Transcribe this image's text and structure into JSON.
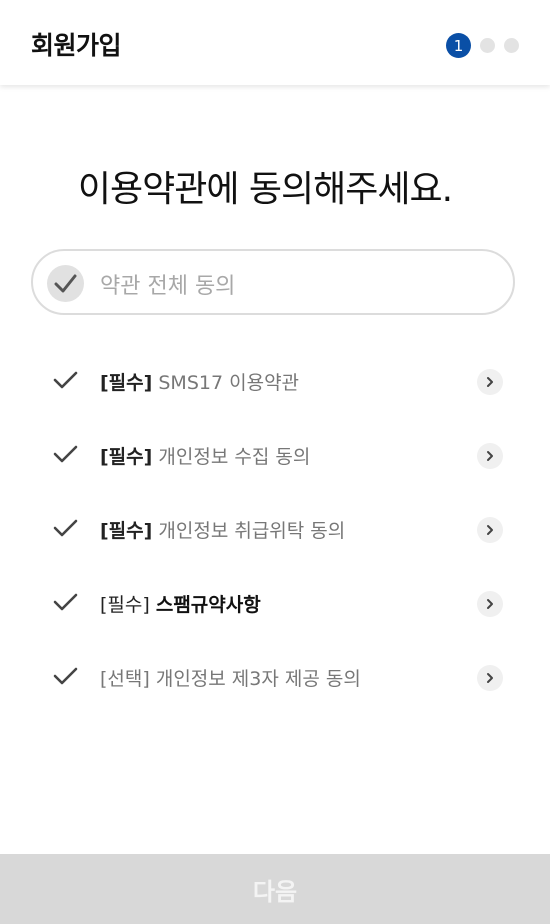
{
  "header": {
    "title": "회원가입",
    "steps": [
      {
        "label": "1",
        "active": true
      },
      {
        "label": "",
        "active": false
      },
      {
        "label": "",
        "active": false
      }
    ]
  },
  "headline": "이용약관에 동의해주세요.",
  "agree_all": {
    "label": "약관 전체 동의",
    "checked": false
  },
  "terms": [
    {
      "tag": "[필수]",
      "name": "SMS17 이용약관",
      "bold_name": false,
      "optional": false
    },
    {
      "tag": "[필수]",
      "name": "개인정보 수집 동의",
      "bold_name": false,
      "optional": false
    },
    {
      "tag": "[필수]",
      "name": "개인정보 취급위탁 동의",
      "bold_name": false,
      "optional": false
    },
    {
      "tag": "[필수]",
      "name": "스팸규약사항",
      "bold_name": true,
      "optional": false
    },
    {
      "tag": "[선택]",
      "name": "개인정보 제3자 제공 동의",
      "bold_name": false,
      "optional": true
    }
  ],
  "next_button": {
    "label": "다음",
    "enabled": false
  },
  "colors": {
    "accent": "#0a4fa6",
    "disabled": "#d8d8d8"
  },
  "icons": {
    "check": "check-icon",
    "chevron": "chevron-right-icon"
  }
}
